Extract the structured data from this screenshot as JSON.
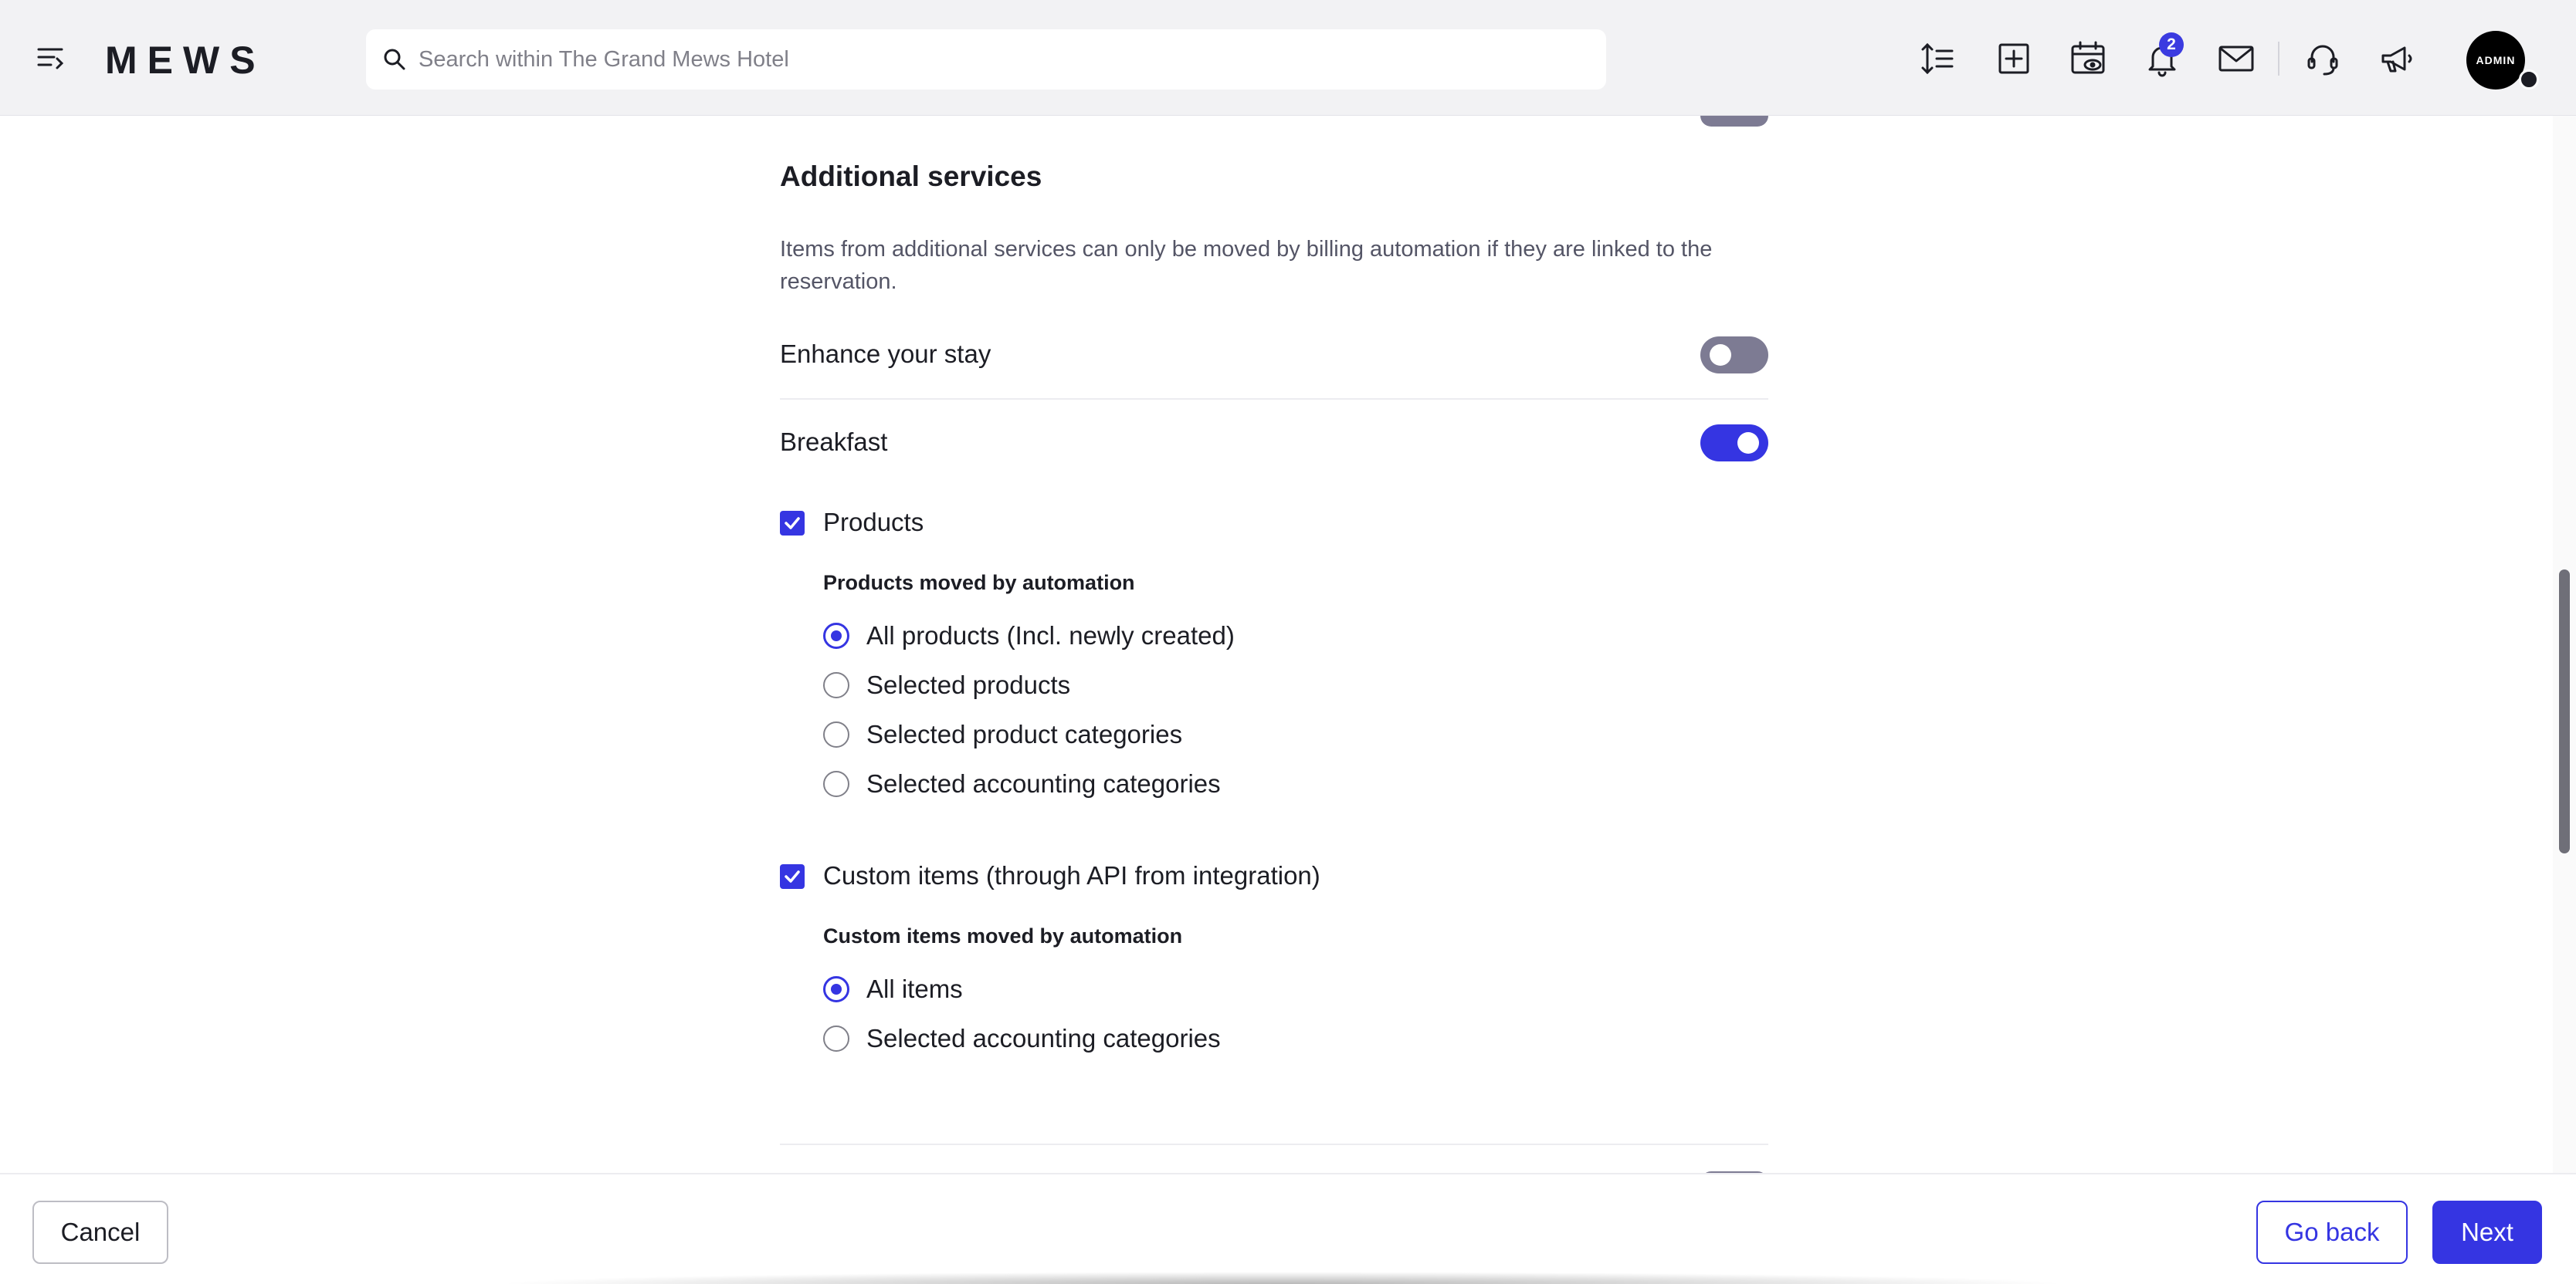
{
  "app": {
    "logo": "MEWS"
  },
  "search": {
    "placeholder": "Search within The Grand Mews Hotel"
  },
  "toolbar": {
    "icons": [
      "menu-icon",
      "sort-lines-icon",
      "plus-square-icon",
      "calendar-eye-icon",
      "bell-icon",
      "mail-icon",
      "headset-icon",
      "megaphone-icon"
    ],
    "notification_count": "2",
    "avatar_label": "ADMIN"
  },
  "section": {
    "title": "Additional services",
    "description": "Items from additional services can only be moved by billing automation if they are linked to the reservation."
  },
  "services": [
    {
      "label": "Enhance your stay",
      "enabled": false
    },
    {
      "label": "Breakfast",
      "enabled": true
    }
  ],
  "products": {
    "label": "Products",
    "checked": true,
    "sub_heading": "Products moved by automation",
    "options": [
      {
        "label": "All products (Incl. newly created)",
        "selected": true
      },
      {
        "label": "Selected products",
        "selected": false
      },
      {
        "label": "Selected product categories",
        "selected": false
      },
      {
        "label": "Selected accounting categories",
        "selected": false
      }
    ]
  },
  "custom_items": {
    "label": "Custom items (through API from integration)",
    "checked": true,
    "sub_heading": "Custom items moved by automation",
    "options": [
      {
        "label": "All items",
        "selected": true
      },
      {
        "label": "Selected accounting categories",
        "selected": false
      }
    ]
  },
  "footer": {
    "cancel": "Cancel",
    "go_back": "Go back",
    "next": "Next"
  },
  "colors": {
    "accent": "#3535e2",
    "toggle_off": "#7d7b93",
    "topbar": "#f2f2f4"
  }
}
